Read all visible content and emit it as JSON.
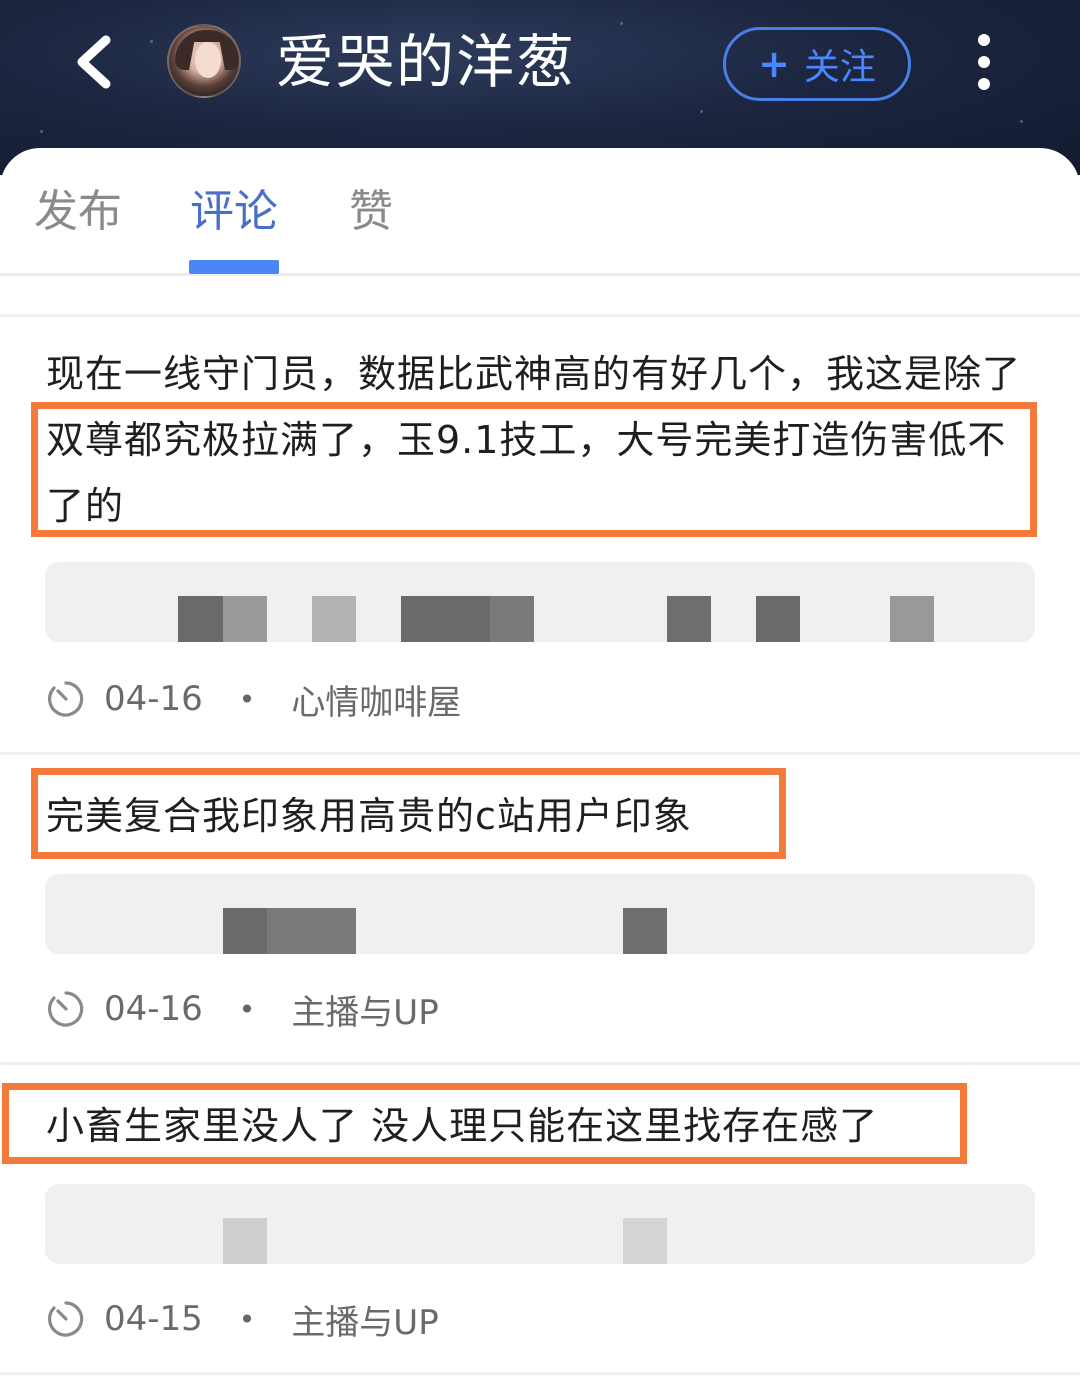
{
  "header": {
    "title": "爱哭的洋葱",
    "follow_label": "关注",
    "follow_plus": "+"
  },
  "tabs": [
    {
      "label": "发布"
    },
    {
      "label": "评论"
    },
    {
      "label": "赞"
    }
  ],
  "comments": [
    {
      "text": "现在一线守门员，数据比武神高的有好几个，我这是除了双尊都究极拉满了，玉9.1技工，大号完美打造伤害低不了的",
      "date": "04-16",
      "separator": "•",
      "topic": "心情咖啡屋"
    },
    {
      "text": "完美复合我印象用高贵的c站用户印象",
      "date": "04-16",
      "separator": "•",
      "topic": "主播与UP"
    },
    {
      "text": "小畜生家里没人了 没人理只能在这里找存在感了",
      "date": "04-15",
      "separator": "•",
      "topic": "主播与UP"
    }
  ],
  "colors": {
    "highlight": "#f47a3c",
    "accent": "#4a86f6",
    "header_bg": "#1c2640"
  },
  "icons": [
    "back-arrow-icon",
    "avatar",
    "plus-icon",
    "more-vertical-icon",
    "clock-icon"
  ]
}
